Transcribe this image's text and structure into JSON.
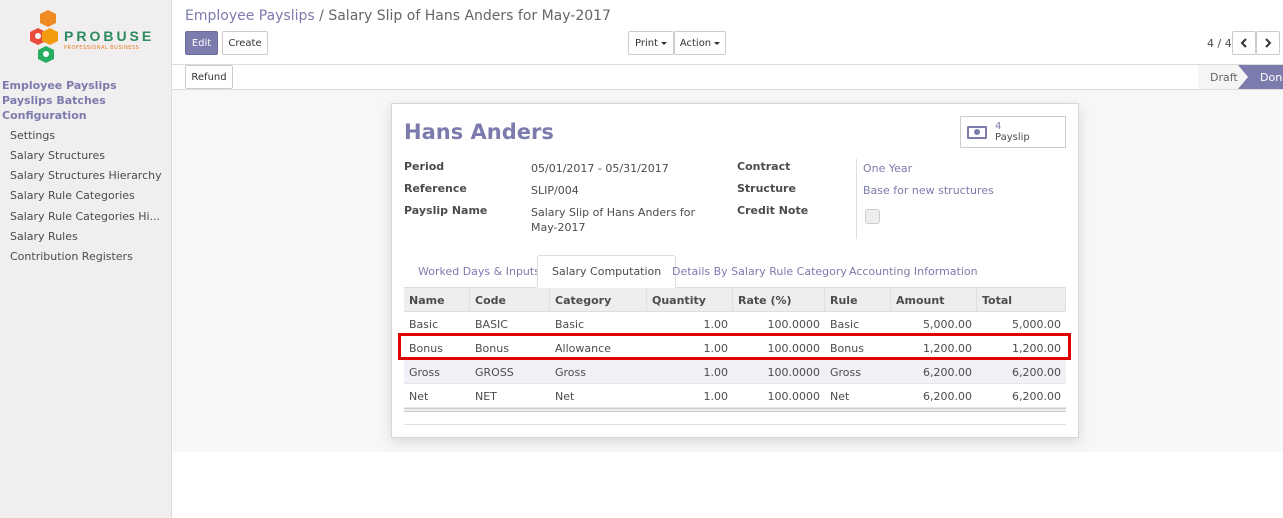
{
  "logo": {
    "text": "PROBUSE",
    "tagline": "PROFESSIONAL BUSINESS"
  },
  "sidebar": {
    "heads": [
      "Employee Payslips",
      "Payslips Batches",
      "Configuration"
    ],
    "items": [
      "Settings",
      "Salary Structures",
      "Salary Structures Hierarchy",
      "Salary Rule Categories",
      "Salary Rule Categories Hi...",
      "Salary Rules",
      "Contribution Registers"
    ]
  },
  "breadcrumb": {
    "parent": "Employee Payslips",
    "separator": "/",
    "current": "Salary Slip of Hans Anders for May-2017"
  },
  "toolbar": {
    "edit": "Edit",
    "create": "Create",
    "print": "Print",
    "action": "Action",
    "refund": "Refund"
  },
  "pager": {
    "value": "4 / 4",
    "prev_icon": "chevron-left-icon",
    "next_icon": "chevron-right-icon"
  },
  "status": {
    "stages": [
      "Draft",
      "Done"
    ],
    "current": "Done"
  },
  "form": {
    "employee": "Hans Anders",
    "smart_button": {
      "count": "4",
      "label": "Payslip",
      "icon": "money-icon"
    },
    "labels": {
      "period": "Period",
      "reference": "Reference",
      "payslip_name": "Payslip Name",
      "contract": "Contract",
      "structure": "Structure",
      "credit_note": "Credit Note"
    },
    "values": {
      "period": "05/01/2017 - 05/31/2017",
      "reference": "SLIP/004",
      "payslip_name_1": "Salary Slip of Hans Anders for",
      "payslip_name_2": "May-2017",
      "contract": "One Year",
      "structure": "Base for new structures",
      "credit_note": false
    }
  },
  "tabs": [
    "Worked Days & Inputs",
    "Salary Computation",
    "Details By Salary Rule Category",
    "Accounting Information"
  ],
  "active_tab": "Salary Computation",
  "table": {
    "headers": [
      "Name",
      "Code",
      "Category",
      "Quantity",
      "Rate (%)",
      "Rule",
      "Amount",
      "Total"
    ],
    "rows": [
      [
        "Basic",
        "BASIC",
        "Basic",
        "1.00",
        "100.0000",
        "Basic",
        "5,000.00",
        "5,000.00"
      ],
      [
        "Bonus",
        "Bonus",
        "Allowance",
        "1.00",
        "100.0000",
        "Bonus",
        "1,200.00",
        "1,200.00"
      ],
      [
        "Gross",
        "GROSS",
        "Gross",
        "1.00",
        "100.0000",
        "Gross",
        "6,200.00",
        "6,200.00"
      ],
      [
        "Net",
        "NET",
        "Net",
        "1.00",
        "100.0000",
        "Net",
        "6,200.00",
        "6,200.00"
      ]
    ],
    "highlighted_row": 1
  },
  "colors": {
    "primary": "#7c7bad",
    "highlight": "#e00000"
  }
}
